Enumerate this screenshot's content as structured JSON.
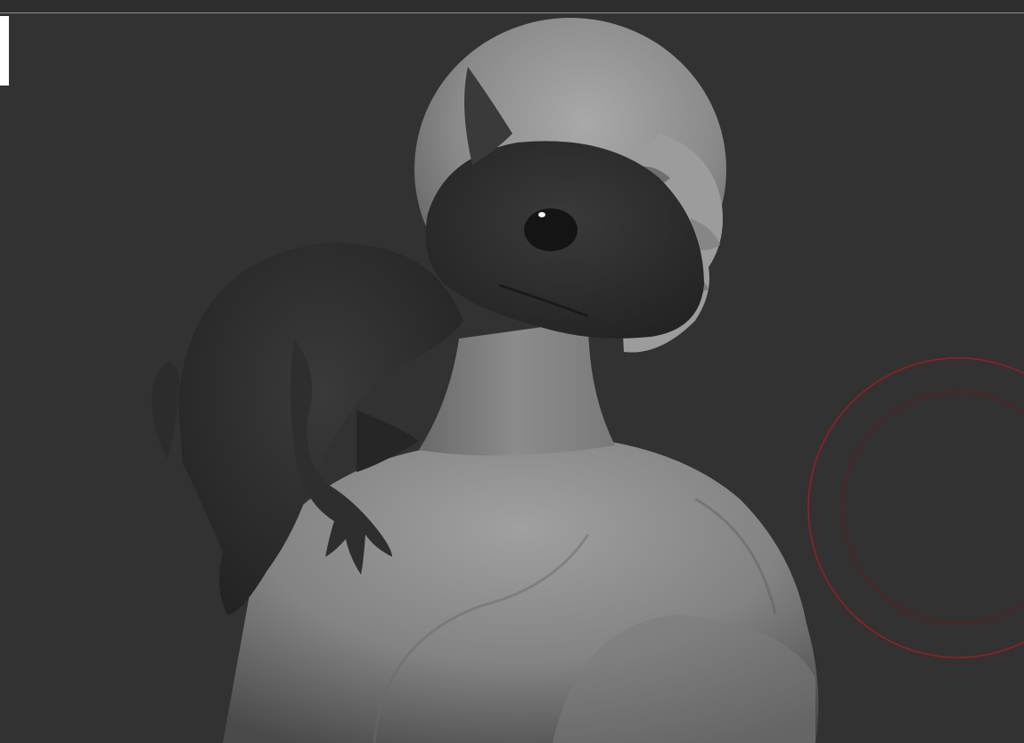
{
  "app": {
    "viewport_background": "#323232",
    "top_line_color": "#8a8a8a",
    "handle_color": "#ffffff"
  },
  "scene": {
    "body_color": "#8f8f8f",
    "body_shadow_color": "#5a5a5a",
    "creature_color": "#2a2a2a",
    "creature_highlight": "#3a3a3a"
  },
  "brush": {
    "outer_ring_color": "#9a1f1f",
    "inner_ring_color": "#6a1a1a",
    "icon": "brush-draw-size-circle"
  }
}
